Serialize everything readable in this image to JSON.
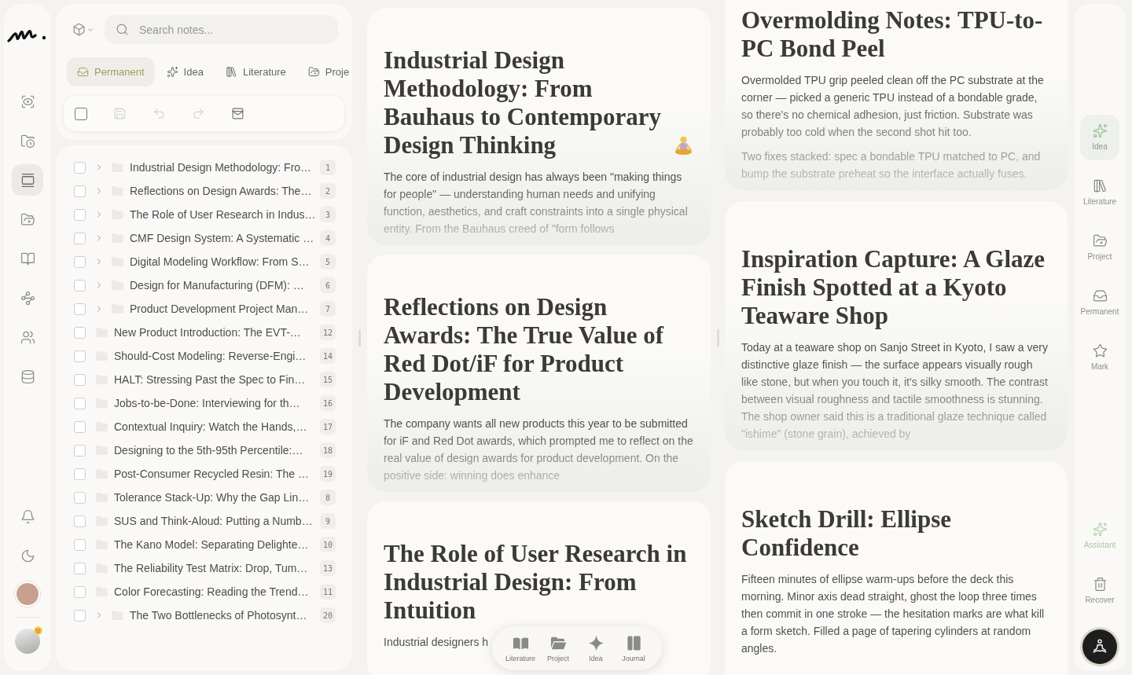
{
  "left_rail": {
    "items": [
      {
        "selected": false
      },
      {
        "selected": false
      },
      {
        "selected": true
      },
      {
        "selected": false
      },
      {
        "selected": false
      },
      {
        "selected": false
      },
      {
        "selected": false
      },
      {
        "selected": false
      }
    ]
  },
  "search": {
    "placeholder": "Search notes..."
  },
  "category_tabs": [
    {
      "label": "Permanent",
      "selected": true
    },
    {
      "label": "Idea",
      "selected": false
    },
    {
      "label": "Literature",
      "selected": false
    },
    {
      "label": "Proje",
      "selected": false
    }
  ],
  "toolbar": {
    "select_all_checked": false,
    "actions": [
      {
        "disabled": true
      },
      {
        "disabled": true
      },
      {
        "disabled": true
      },
      {
        "disabled": false
      }
    ]
  },
  "notes_list": [
    {
      "title": "Industrial Design Methodology: Fro…",
      "count": "1",
      "has_children": true,
      "checked": false
    },
    {
      "title": "Reflections on Design Awards: The…",
      "count": "2",
      "has_children": true,
      "checked": false
    },
    {
      "title": "The Role of User Research in Indus…",
      "count": "3",
      "has_children": true,
      "checked": false
    },
    {
      "title": "CMF Design System: A Systematic …",
      "count": "4",
      "has_children": true,
      "checked": false
    },
    {
      "title": "Digital Modeling Workflow: From S…",
      "count": "5",
      "has_children": true,
      "checked": false
    },
    {
      "title": "Design for Manufacturing (DFM): …",
      "count": "6",
      "has_children": true,
      "checked": false
    },
    {
      "title": "Product Development Project Man…",
      "count": "7",
      "has_children": true,
      "checked": false
    },
    {
      "title": "New Product Introduction: The EVT-…",
      "count": "12",
      "has_children": false,
      "checked": false
    },
    {
      "title": "Should-Cost Modeling: Reverse-Engi…",
      "count": "14",
      "has_children": false,
      "checked": false
    },
    {
      "title": "HALT: Stressing Past the Spec to Fin…",
      "count": "15",
      "has_children": false,
      "checked": false
    },
    {
      "title": "Jobs-to-be-Done: Interviewing for th…",
      "count": "16",
      "has_children": false,
      "checked": false
    },
    {
      "title": "Contextual Inquiry: Watch the Hands,…",
      "count": "17",
      "has_children": false,
      "checked": false
    },
    {
      "title": "Designing to the 5th-95th Percentile:…",
      "count": "18",
      "has_children": false,
      "checked": false
    },
    {
      "title": "Post-Consumer Recycled Resin: The …",
      "count": "19",
      "has_children": false,
      "checked": false
    },
    {
      "title": "Tolerance Stack-Up: Why the Gap Lin…",
      "count": "8",
      "has_children": false,
      "checked": false
    },
    {
      "title": "SUS and Think-Aloud: Putting a Numb…",
      "count": "9",
      "has_children": false,
      "checked": false
    },
    {
      "title": "The Kano Model: Separating Delighte…",
      "count": "10",
      "has_children": false,
      "checked": false
    },
    {
      "title": "The Reliability Test Matrix: Drop, Tum…",
      "count": "13",
      "has_children": false,
      "checked": false
    },
    {
      "title": "Color Forecasting: Reading the Trend…",
      "count": "11",
      "has_children": false,
      "checked": false
    },
    {
      "title": "The Two Bottlenecks of Photosynt…",
      "count": "20",
      "has_children": true,
      "checked": false
    }
  ],
  "columns": [
    {
      "cards": [
        {
          "title": "Industrial Design Methodology: From Bauhaus to Contemporary Design Thinking",
          "title_icon": true,
          "paragraphs": [
            "The core of industrial design has always been \"making things for people\" — understanding human needs and unifying function, aesthetics, and craft constraints into a single physical entity. From the Bauhaus creed of \"form follows"
          ],
          "collapsed": true
        },
        {
          "title": "Reflections on Design Awards: The True Value of Red Dot/iF for Product Development",
          "paragraphs": [
            "The company wants all new products this year to be submitted for iF and Red Dot awards, which prompted me to reflect on the real value of design awards for product development. On the positive side: winning does enhance"
          ],
          "collapsed": true
        },
        {
          "title": "The Role of User Research in Industrial Design: From Intuition",
          "paragraphs": [
            "Industrial designers h"
          ],
          "collapsed": false
        }
      ]
    },
    {
      "cards": [
        {
          "title": "Overmolding Notes: TPU-to-PC Bond Peel",
          "paragraphs": [
            "Overmolded TPU grip peeled clean off the PC substrate at the corner — picked a generic TPU instead of a bondable grade, so there's no chemical adhesion, just friction. Substrate was probably too cold when the second shot hit too.",
            "Two fixes stacked: spec a bondable TPU matched to PC, and bump the substrate preheat so the interface actually fuses."
          ],
          "collapsed": true
        },
        {
          "title": "Inspiration Capture: A Glaze Finish Spotted at a Kyoto Teaware Shop",
          "paragraphs": [
            "Today at a teaware shop on Sanjo Street in Kyoto, I saw a very distinctive glaze finish — the surface appears visually rough like stone, but when you touch it, it's silky smooth. The contrast between visual roughness and tactile smoothness is stunning. The shop owner said this is a traditional glaze technique called \"ishime\" (stone grain), achieved by"
          ],
          "collapsed": true
        },
        {
          "title": "Sketch Drill: Ellipse Confidence",
          "paragraphs": [
            "Fifteen minutes of ellipse warm-ups before the deck this morning. Minor axis dead straight, ghost the loop three times then commit in one stroke — the hesitation marks are what kill a form sketch. Filled a page of tapering cylinders at random angles."
          ],
          "collapsed": false
        }
      ]
    }
  ],
  "bottom_dock": [
    {
      "label": "Literature"
    },
    {
      "label": "Project"
    },
    {
      "label": "Idea"
    },
    {
      "label": "Journal"
    }
  ],
  "right_rail": {
    "items": [
      {
        "label": "Idea",
        "selected": true
      },
      {
        "label": "Literature",
        "selected": false
      },
      {
        "label": "Project",
        "selected": false
      },
      {
        "label": "Permanent",
        "selected": false
      },
      {
        "label": "Mark",
        "selected": false
      }
    ],
    "tools": [
      {
        "label": "Assistant",
        "active": true
      },
      {
        "label": "Recover",
        "active": false
      }
    ]
  }
}
